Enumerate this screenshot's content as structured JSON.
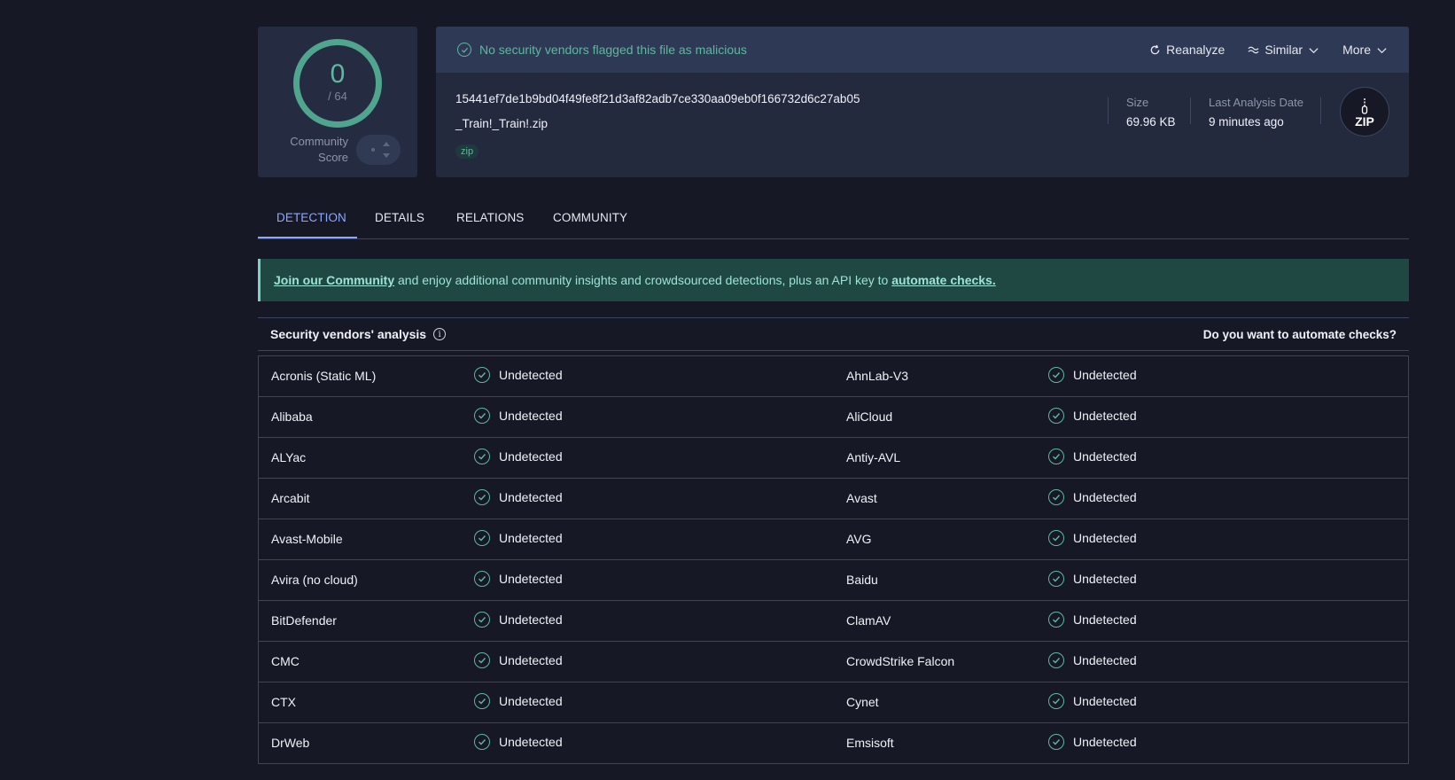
{
  "score": {
    "detections": "0",
    "total": "/ 64",
    "community_label_1": "Community",
    "community_label_2": "Score"
  },
  "status": {
    "message": "No security vendors flagged this file as malicious"
  },
  "actions": {
    "reanalyze": "Reanalyze",
    "similar": "Similar",
    "more": "More"
  },
  "file": {
    "hash": "15441ef7de1b9bd04f49fe8f21d3af82adb7ce330aa09eb0f166732d6c27ab05",
    "name": "_Train!_Train!.zip",
    "tag": "zip",
    "size_label": "Size",
    "size_value": "69.96 KB",
    "date_label": "Last Analysis Date",
    "date_value": "9 minutes ago",
    "type_badge": "ZIP"
  },
  "tabs": [
    "DETECTION",
    "DETAILS",
    "RELATIONS",
    "COMMUNITY"
  ],
  "banner": {
    "link1": "Join our Community",
    "middle": " and enjoy additional community insights and crowdsourced detections, plus an API key to ",
    "link2": "automate checks."
  },
  "vendors_section": {
    "title": "Security vendors' analysis",
    "automate": "Do you want to automate checks?"
  },
  "vendors": [
    [
      {
        "name": "Acronis (Static ML)",
        "result": "Undetected"
      },
      {
        "name": "AhnLab-V3",
        "result": "Undetected"
      }
    ],
    [
      {
        "name": "Alibaba",
        "result": "Undetected"
      },
      {
        "name": "AliCloud",
        "result": "Undetected"
      }
    ],
    [
      {
        "name": "ALYac",
        "result": "Undetected"
      },
      {
        "name": "Antiy-AVL",
        "result": "Undetected"
      }
    ],
    [
      {
        "name": "Arcabit",
        "result": "Undetected"
      },
      {
        "name": "Avast",
        "result": "Undetected"
      }
    ],
    [
      {
        "name": "Avast-Mobile",
        "result": "Undetected"
      },
      {
        "name": "AVG",
        "result": "Undetected"
      }
    ],
    [
      {
        "name": "Avira (no cloud)",
        "result": "Undetected"
      },
      {
        "name": "Baidu",
        "result": "Undetected"
      }
    ],
    [
      {
        "name": "BitDefender",
        "result": "Undetected"
      },
      {
        "name": "ClamAV",
        "result": "Undetected"
      }
    ],
    [
      {
        "name": "CMC",
        "result": "Undetected"
      },
      {
        "name": "CrowdStrike Falcon",
        "result": "Undetected"
      }
    ],
    [
      {
        "name": "CTX",
        "result": "Undetected"
      },
      {
        "name": "Cynet",
        "result": "Undetected"
      }
    ],
    [
      {
        "name": "DrWeb",
        "result": "Undetected"
      },
      {
        "name": "Emsisoft",
        "result": "Undetected"
      }
    ]
  ]
}
